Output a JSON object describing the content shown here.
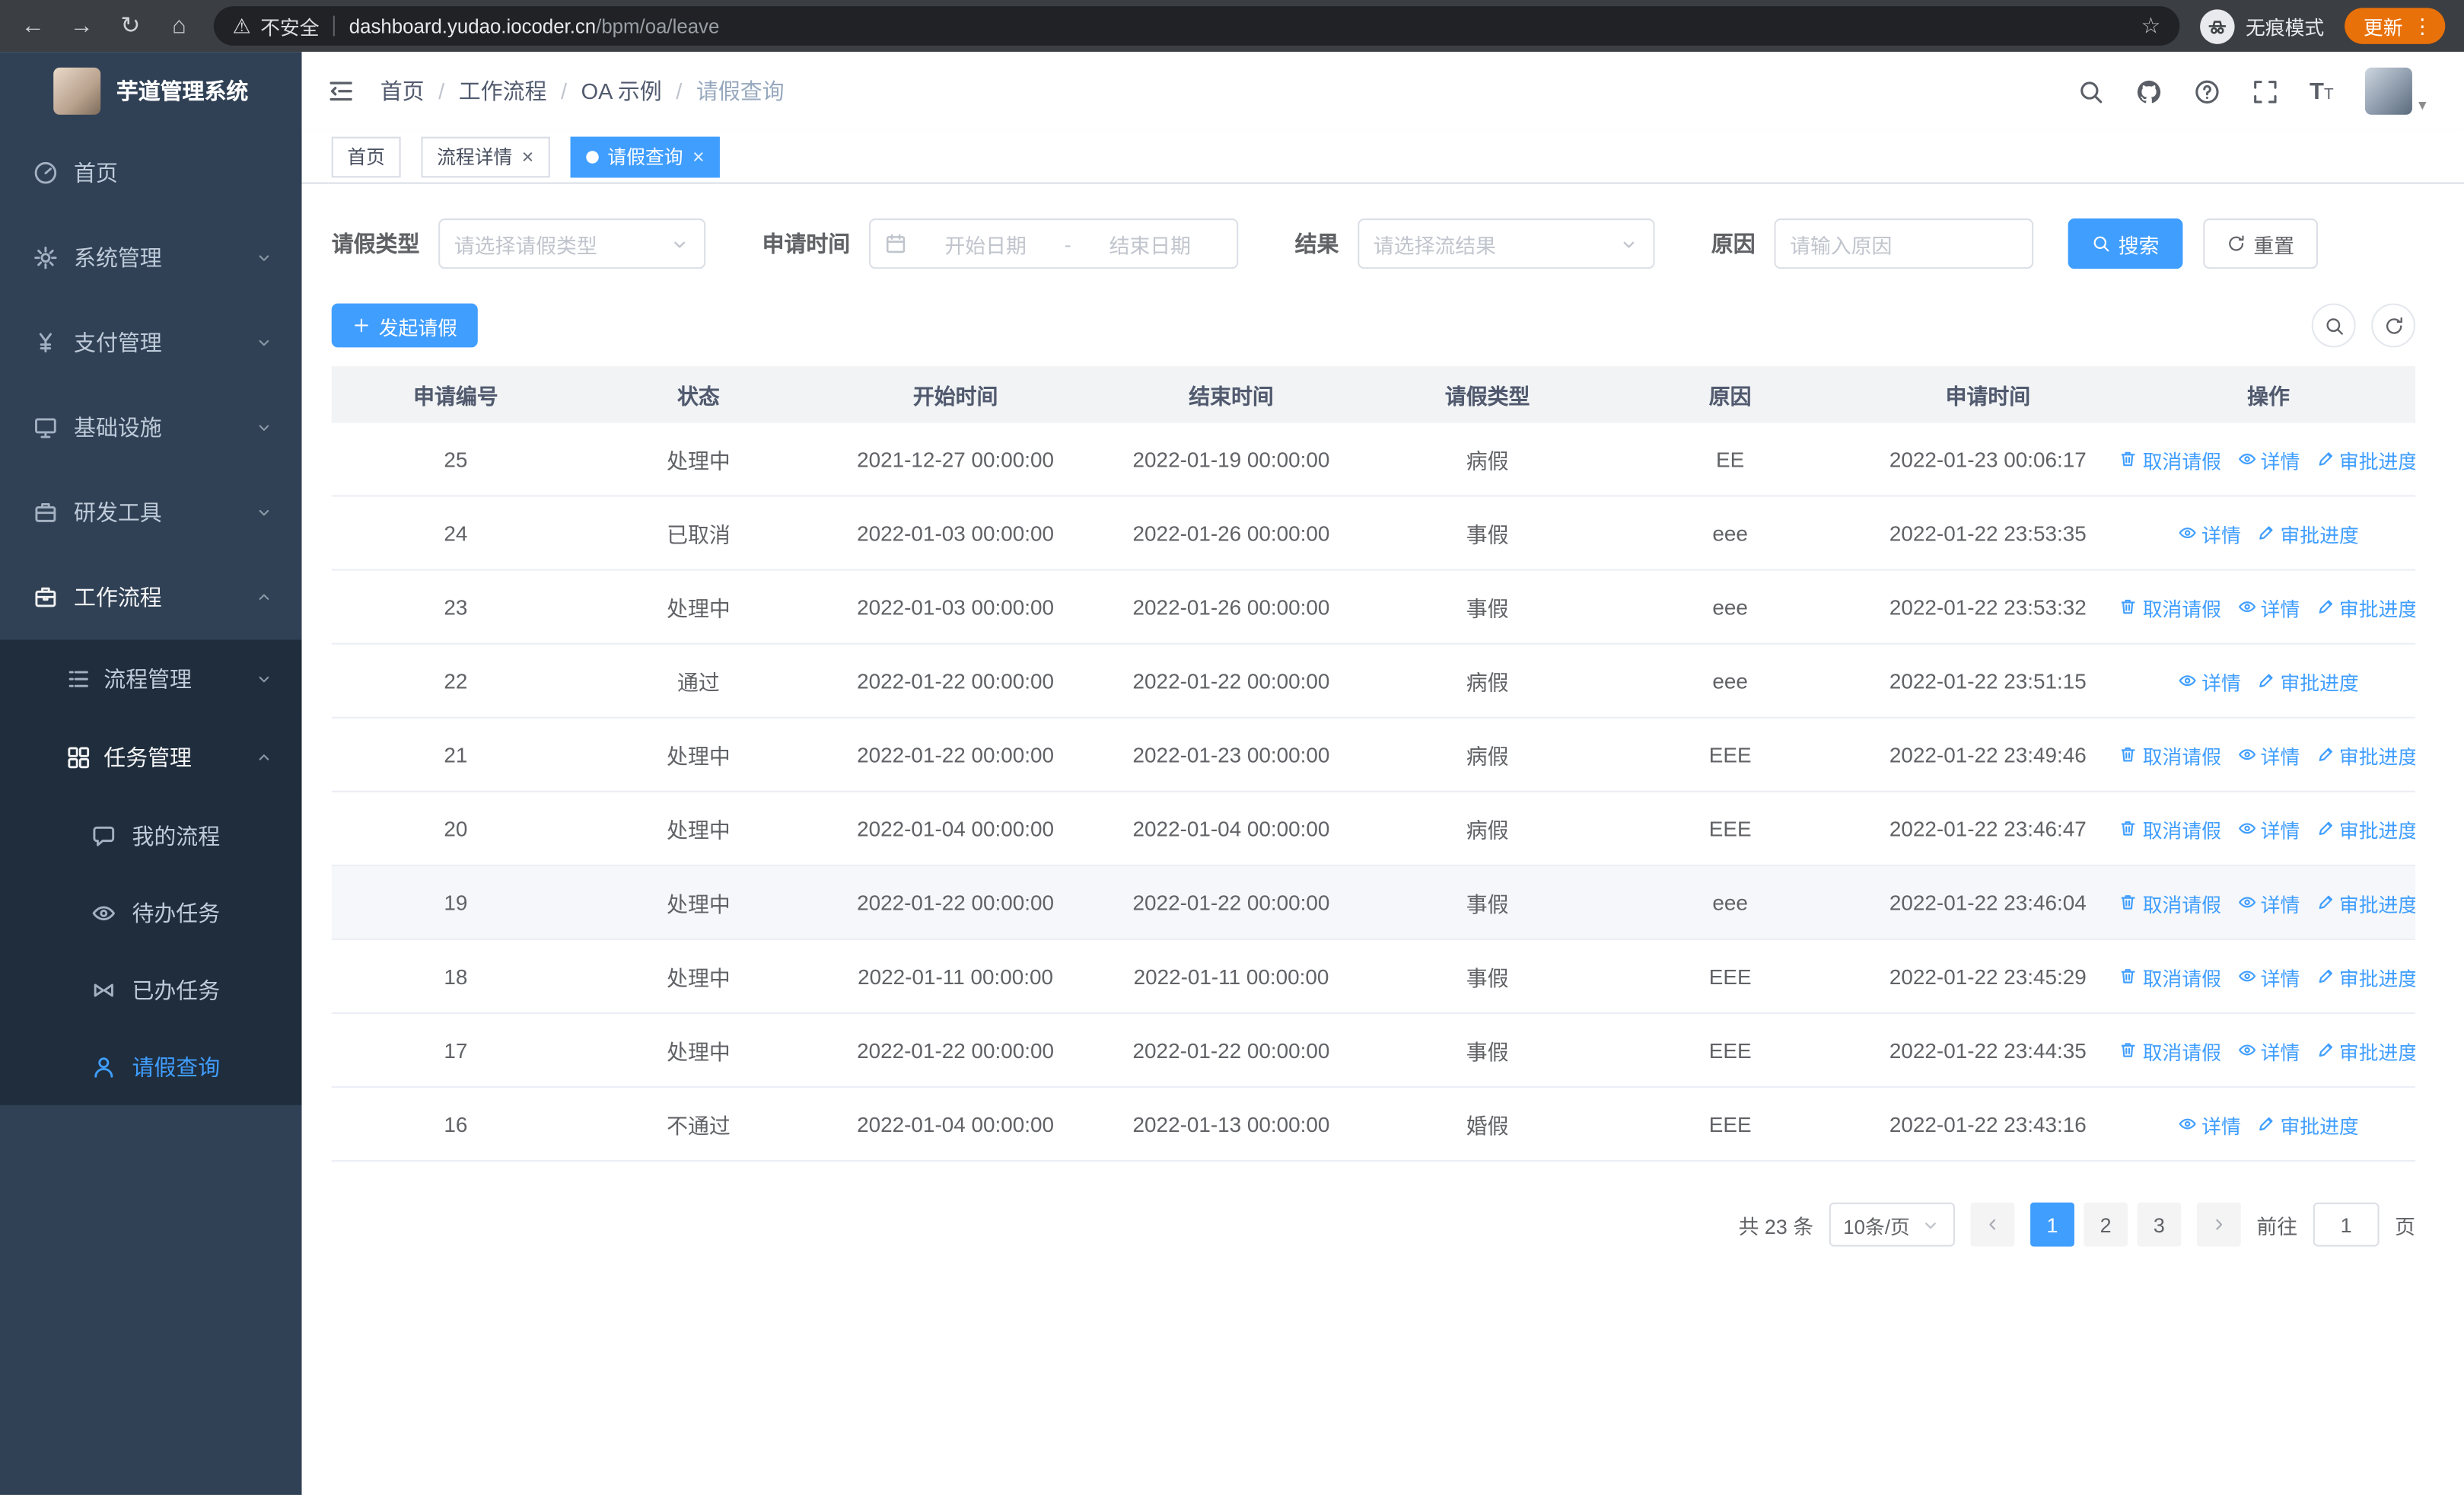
{
  "colors": {
    "primary": "#409eff",
    "update_badge": "#e8710a",
    "sidebar_bg": "#304156",
    "sidebar_submenu_bg": "#1f2d3d"
  },
  "browser": {
    "security_warning": "不安全",
    "url_domain": "dashboard.yudao.iocoder.cn",
    "url_path": "/bpm/oa/leave",
    "incognito_label": "无痕模式",
    "update_label": "更新"
  },
  "sidebar": {
    "logo_title": "芋道管理系统",
    "items": [
      {
        "key": "home",
        "label": "首页",
        "icon": "dashboard-icon",
        "level": 1
      },
      {
        "key": "system",
        "label": "系统管理",
        "icon": "gear-icon",
        "level": 1,
        "expand": "down"
      },
      {
        "key": "payment",
        "label": "支付管理",
        "icon": "payment-icon",
        "level": 1,
        "expand": "down"
      },
      {
        "key": "infrastructure",
        "label": "基础设施",
        "icon": "infra-icon",
        "level": 1,
        "expand": "down"
      },
      {
        "key": "dev-tools",
        "label": "研发工具",
        "icon": "tools-icon",
        "level": 1,
        "expand": "down"
      },
      {
        "key": "workflow",
        "label": "工作流程",
        "icon": "workflow-icon",
        "level": 1,
        "expand": "up",
        "open": true
      },
      {
        "key": "process-mgmt",
        "label": "流程管理",
        "icon": "process-icon",
        "level": 2,
        "expand": "down"
      },
      {
        "key": "task-mgmt",
        "label": "任务管理",
        "icon": "task-icon",
        "level": 2,
        "expand": "up",
        "open": true
      },
      {
        "key": "my-process",
        "label": "我的流程",
        "icon": "chat-icon",
        "level": 3
      },
      {
        "key": "todo-tasks",
        "label": "待办任务",
        "icon": "eye-icon",
        "level": 3
      },
      {
        "key": "done-tasks",
        "label": "已办任务",
        "icon": "bowtie-icon",
        "level": 3
      },
      {
        "key": "leave-query",
        "label": "请假查询",
        "icon": "person-icon",
        "level": 3,
        "active": true
      }
    ]
  },
  "navbar": {
    "breadcrumb": [
      "首页",
      "工作流程",
      "OA 示例",
      "请假查询"
    ]
  },
  "tags": [
    {
      "label": "首页",
      "closable": false,
      "active": false
    },
    {
      "label": "流程详情",
      "closable": true,
      "active": false
    },
    {
      "label": "请假查询",
      "closable": true,
      "active": true
    }
  ],
  "filters": {
    "leave_type_label": "请假类型",
    "leave_type_placeholder": "请选择请假类型",
    "apply_time_label": "申请时间",
    "start_date_placeholder": "开始日期",
    "range_separator": "-",
    "end_date_placeholder": "结束日期",
    "result_label": "结果",
    "result_placeholder": "请选择流结果",
    "reason_label": "原因",
    "reason_placeholder": "请输入原因",
    "search_label": "搜索",
    "reset_label": "重置"
  },
  "toolbar": {
    "create_label": "发起请假"
  },
  "table": {
    "columns": [
      "申请编号",
      "状态",
      "开始时间",
      "结束时间",
      "请假类型",
      "原因",
      "申请时间",
      "操作"
    ],
    "action_labels": {
      "cancel": "取消请假",
      "detail": "详情",
      "progress": "审批进度"
    },
    "rows": [
      {
        "id": "25",
        "status": "处理中",
        "start": "2021-12-27 00:00:00",
        "end": "2022-01-19 00:00:00",
        "type": "病假",
        "reason": "EE",
        "applied": "2022-01-23 00:06:17",
        "cancelable": true,
        "highlight": false
      },
      {
        "id": "24",
        "status": "已取消",
        "start": "2022-01-03 00:00:00",
        "end": "2022-01-26 00:00:00",
        "type": "事假",
        "reason": "eee",
        "applied": "2022-01-22 23:53:35",
        "cancelable": false,
        "highlight": false
      },
      {
        "id": "23",
        "status": "处理中",
        "start": "2022-01-03 00:00:00",
        "end": "2022-01-26 00:00:00",
        "type": "事假",
        "reason": "eee",
        "applied": "2022-01-22 23:53:32",
        "cancelable": true,
        "highlight": false
      },
      {
        "id": "22",
        "status": "通过",
        "start": "2022-01-22 00:00:00",
        "end": "2022-01-22 00:00:00",
        "type": "病假",
        "reason": "eee",
        "applied": "2022-01-22 23:51:15",
        "cancelable": false,
        "highlight": false
      },
      {
        "id": "21",
        "status": "处理中",
        "start": "2022-01-22 00:00:00",
        "end": "2022-01-23 00:00:00",
        "type": "病假",
        "reason": "EEE",
        "applied": "2022-01-22 23:49:46",
        "cancelable": true,
        "highlight": false
      },
      {
        "id": "20",
        "status": "处理中",
        "start": "2022-01-04 00:00:00",
        "end": "2022-01-04 00:00:00",
        "type": "病假",
        "reason": "EEE",
        "applied": "2022-01-22 23:46:47",
        "cancelable": true,
        "highlight": false
      },
      {
        "id": "19",
        "status": "处理中",
        "start": "2022-01-22 00:00:00",
        "end": "2022-01-22 00:00:00",
        "type": "事假",
        "reason": "eee",
        "applied": "2022-01-22 23:46:04",
        "cancelable": true,
        "highlight": true
      },
      {
        "id": "18",
        "status": "处理中",
        "start": "2022-01-11 00:00:00",
        "end": "2022-01-11 00:00:00",
        "type": "事假",
        "reason": "EEE",
        "applied": "2022-01-22 23:45:29",
        "cancelable": true,
        "highlight": false
      },
      {
        "id": "17",
        "status": "处理中",
        "start": "2022-01-22 00:00:00",
        "end": "2022-01-22 00:00:00",
        "type": "事假",
        "reason": "EEE",
        "applied": "2022-01-22 23:44:35",
        "cancelable": true,
        "highlight": false
      },
      {
        "id": "16",
        "status": "不通过",
        "start": "2022-01-04 00:00:00",
        "end": "2022-01-13 00:00:00",
        "type": "婚假",
        "reason": "EEE",
        "applied": "2022-01-22 23:43:16",
        "cancelable": false,
        "highlight": false
      }
    ]
  },
  "pagination": {
    "total_text": "共 23 条",
    "page_size_label": "10条/页",
    "pages": [
      "1",
      "2",
      "3"
    ],
    "active_page": "1",
    "goto_label": "前往",
    "goto_value": "1",
    "goto_unit": "页"
  }
}
